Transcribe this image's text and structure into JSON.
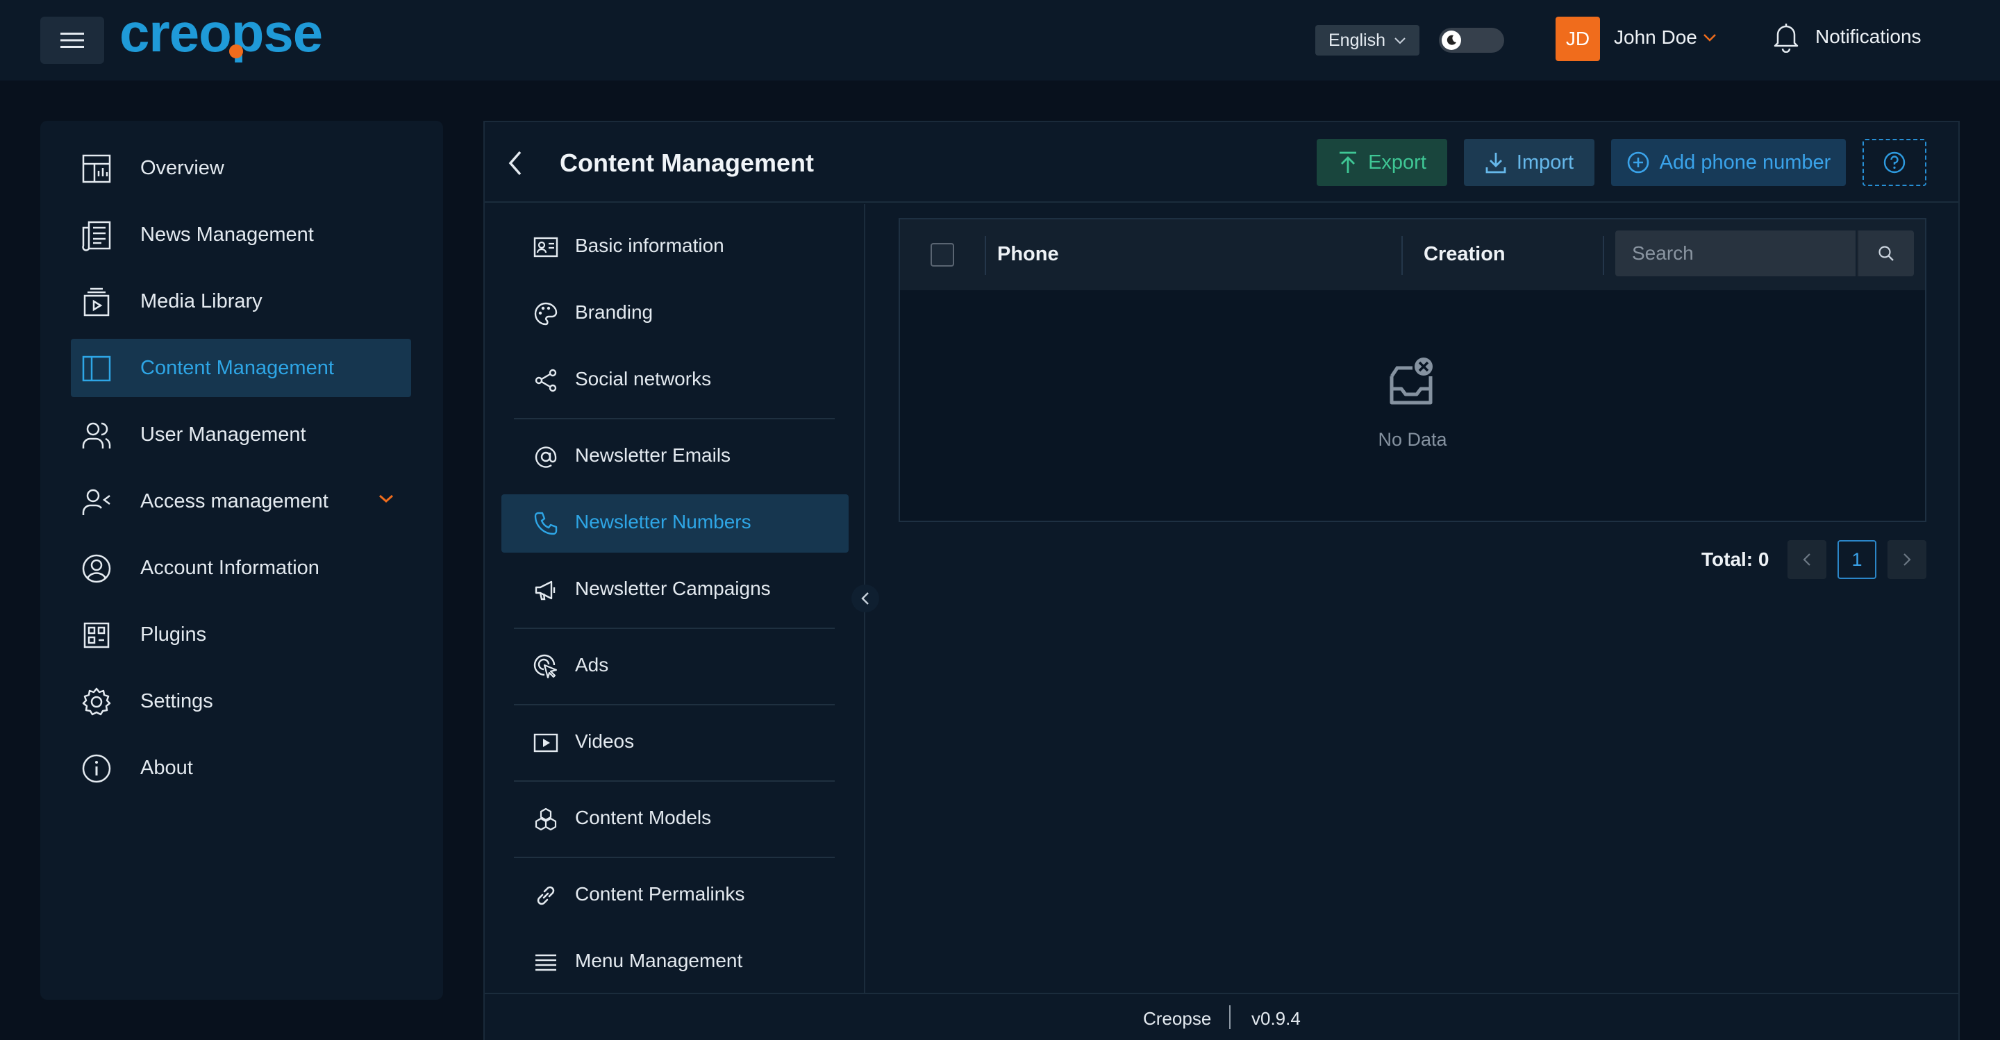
{
  "app": {
    "logo_text": "creopse",
    "accent_color": "#2ea6e6",
    "brand_orange": "#f06c1c"
  },
  "topbar": {
    "language": "English",
    "user": {
      "initials": "JD",
      "name": "John Doe"
    },
    "notifications_label": "Notifications"
  },
  "sidebar": {
    "items": [
      {
        "label": "Overview",
        "icon": "dashboard-icon"
      },
      {
        "label": "News Management",
        "icon": "newspaper-icon"
      },
      {
        "label": "Media Library",
        "icon": "media-library-icon"
      },
      {
        "label": "Content Management",
        "icon": "layout-sidebar-icon",
        "active": true
      },
      {
        "label": "User Management",
        "icon": "users-icon"
      },
      {
        "label": "Access management",
        "icon": "user-access-icon",
        "expandable": true
      },
      {
        "label": "Account Information",
        "icon": "user-circle-icon"
      },
      {
        "label": "Plugins",
        "icon": "plugins-icon"
      },
      {
        "label": "Settings",
        "icon": "gear-icon"
      },
      {
        "label": "About",
        "icon": "info-icon"
      }
    ]
  },
  "page": {
    "title": "Content Management",
    "actions": {
      "export": "Export",
      "import": "Import",
      "add": "Add phone number"
    }
  },
  "submenu": {
    "items": [
      {
        "label": "Basic information",
        "icon": "id-card-icon"
      },
      {
        "label": "Branding",
        "icon": "palette-icon"
      },
      {
        "label": "Social networks",
        "icon": "share-icon"
      },
      {
        "label": "Newsletter Emails",
        "icon": "at-icon"
      },
      {
        "label": "Newsletter Numbers",
        "icon": "phone-icon",
        "active": true
      },
      {
        "label": "Newsletter Campaigns",
        "icon": "megaphone-icon"
      },
      {
        "label": "Ads",
        "icon": "target-click-icon"
      },
      {
        "label": "Videos",
        "icon": "video-icon"
      },
      {
        "label": "Content Models",
        "icon": "cubes-icon"
      },
      {
        "label": "Content Permalinks",
        "icon": "link-icon"
      },
      {
        "label": "Menu Management",
        "icon": "menu-lines-icon"
      }
    ]
  },
  "table": {
    "columns": [
      "Phone",
      "Creation"
    ],
    "search_placeholder": "Search",
    "empty_text": "No Data",
    "rows": []
  },
  "pagination": {
    "total_label": "Total: 0",
    "current_page": "1"
  },
  "footer": {
    "brand": "Creopse",
    "version": "v0.9.4"
  }
}
